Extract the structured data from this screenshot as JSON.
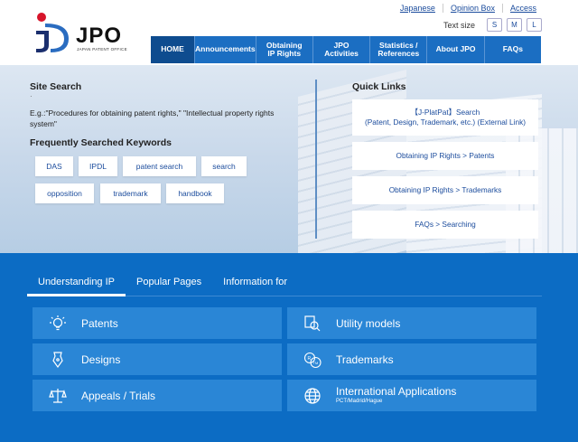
{
  "header": {
    "logo_text": "JPO",
    "logo_sub": "JAPAN PATENT OFFICE",
    "util_links": [
      "Japanese",
      "Opinion Box",
      "Access"
    ],
    "text_size_label": "Text size",
    "text_sizes": [
      "S",
      "M",
      "L"
    ],
    "nav": [
      "HOME",
      "Announcements",
      "Obtaining\nIP Rights",
      "JPO\nActivities",
      "Statistics /\nReferences",
      "About JPO",
      "FAQs"
    ]
  },
  "colors": {
    "nav_blue": "#1b6ec2",
    "nav_active": "#0e4c8f",
    "bottom_blue": "#0c6cc4",
    "tile_blue": "#2a86d6",
    "link_blue": "#1a4b9c"
  },
  "hero": {
    "search_title": "Site Search",
    "search_dot": "·",
    "search_example": "E.g.:\"Procedures for obtaining patent rights,\" \"Intellectual property rights system\"",
    "keywords_title": "Frequently Searched Keywords",
    "keywords": [
      "DAS",
      "IPDL",
      "patent search",
      "search",
      "opposition",
      "trademark",
      "handbook"
    ],
    "quick_links_title": "Quick Links",
    "quick_links": [
      "【J-PlatPat】Search\n(Patent, Design, Trademark, etc.) (External Link)",
      "Obtaining IP Rights > Patents",
      "Obtaining IP Rights > Trademarks",
      "FAQs > Searching"
    ]
  },
  "bottom": {
    "tabs": [
      "Understanding IP",
      "Popular Pages",
      "Information for"
    ],
    "tiles": [
      {
        "label": "Patents",
        "icon": "lightbulb-icon"
      },
      {
        "label": "Utility models",
        "icon": "utility-model-icon"
      },
      {
        "label": "Designs",
        "icon": "pen-nib-icon"
      },
      {
        "label": "Trademarks",
        "icon": "trademark-icon"
      },
      {
        "label": "Appeals / Trials",
        "icon": "scales-icon"
      },
      {
        "label": "International Applications",
        "sub": "PCT/Madrid/Hague",
        "icon": "globe-icon"
      }
    ]
  }
}
